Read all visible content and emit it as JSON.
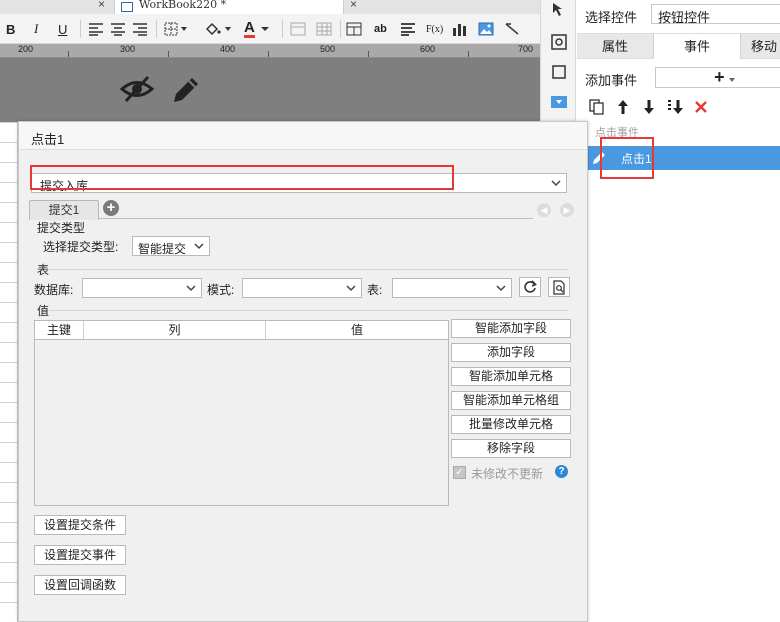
{
  "app": {
    "doc_tab_label": "WorkBook220 *",
    "tab_close": "×"
  },
  "toolbar": {
    "bold": "B",
    "italic": "I",
    "underline": "U",
    "text_a": "A",
    "text_ab": "ab",
    "formula": "F(x)"
  },
  "ruler": {
    "marks": [
      "200",
      "300",
      "400",
      "500",
      "600",
      "700"
    ]
  },
  "right_panel": {
    "select_control_label": "选择控件",
    "select_control_value": "按钮控件",
    "tabs": [
      "属性",
      "事件",
      "移动"
    ],
    "add_event_label": "添加事件",
    "add_event_plus": "+",
    "click_events_label": "点击事件",
    "event_item": "点击1"
  },
  "dialog": {
    "title": "点击1",
    "action_type": "提交入库",
    "sub_tab": "提交1",
    "submit_type_section": "提交类型",
    "select_submit_type_label": "选择提交类型:",
    "submit_type_value": "智能提交",
    "table_section": "表",
    "database_label": "数据库:",
    "database_value": "",
    "mode_label": "模式:",
    "mode_value": "",
    "table_label": "表:",
    "table_value": "",
    "values_section": "值",
    "grid_headers": [
      "主键",
      "列",
      "值"
    ],
    "side_buttons": [
      "智能添加字段",
      "添加字段",
      "智能添加单元格",
      "智能添加单元格组",
      "批量修改单元格",
      "移除字段"
    ],
    "unmodified_no_update": "未修改不更新",
    "help": "?",
    "bottom_buttons": [
      "设置提交条件",
      "设置提交事件",
      "设置回调函数"
    ]
  },
  "colors": {
    "accent": "#4a98e0",
    "highlight": "#e53935",
    "canvas": "#7f7f7f"
  }
}
